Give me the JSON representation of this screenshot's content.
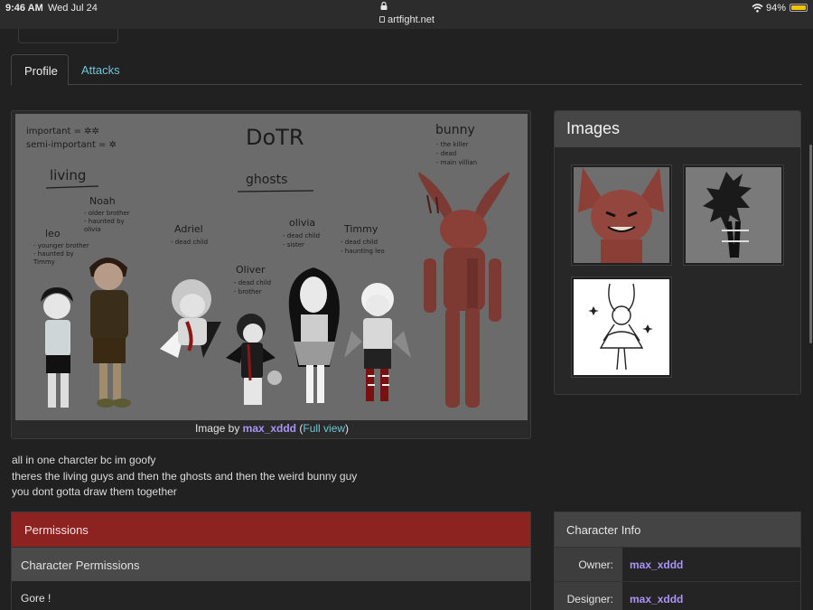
{
  "status_bar": {
    "time": "9:46 AM",
    "date": "Wed Jul 24",
    "url": "artfight.net",
    "battery": "94%"
  },
  "tabs": [
    {
      "label": "Profile",
      "active": true
    },
    {
      "label": "Attacks",
      "active": false
    }
  ],
  "main_image": {
    "caption_prefix": "Image by",
    "author": "max_xddd",
    "full_view": "Full view",
    "art_text": {
      "title": "DoTR",
      "legend_line1": "important = ✲✲",
      "legend_line2": "semi-important = ✲",
      "living": "living",
      "ghosts": "ghosts",
      "bunny": "bunny",
      "bunny_notes": [
        "- the killer",
        "- dead",
        "- main villian"
      ],
      "leo": "leo",
      "leo_notes": [
        "- younger brother",
        "- haunted by",
        "  Timmy"
      ],
      "noah": "Noah",
      "noah_notes": [
        "- older brother",
        "- haunted by",
        "  olivia"
      ],
      "adriel": "Adriel",
      "adriel_notes": [
        "- dead child"
      ],
      "oliver": "Oliver",
      "oliver_notes": [
        "- dead child",
        "- brother"
      ],
      "olivia": "olivia",
      "olivia_notes": [
        "- dead child",
        "- sister"
      ],
      "timmy": "Timmy",
      "timmy_notes": [
        "- dead child",
        "- haunting leo"
      ]
    }
  },
  "description": [
    "all in one charcter bc im goofy",
    "theres the living guys and then the ghosts and then the weird bunny guy",
    "you dont gotta draw them together"
  ],
  "permissions": {
    "header": "Permissions",
    "subheader": "Character Permissions",
    "body": "Gore !"
  },
  "images_panel": {
    "title": "Images",
    "thumbnails": [
      "red-bunny-closeup",
      "grayscale-character-sketch",
      "lineart-bunny-girl"
    ]
  },
  "character_info": {
    "title": "Character Info",
    "rows": [
      {
        "label": "Owner:",
        "value": "max_xddd"
      },
      {
        "label": "Designer:",
        "value": "max_xddd"
      }
    ]
  },
  "colors": {
    "accent_link": "#6cc7d6",
    "user_link": "#a995f7",
    "permissions_header": "#8c2320",
    "background": "#212121"
  }
}
